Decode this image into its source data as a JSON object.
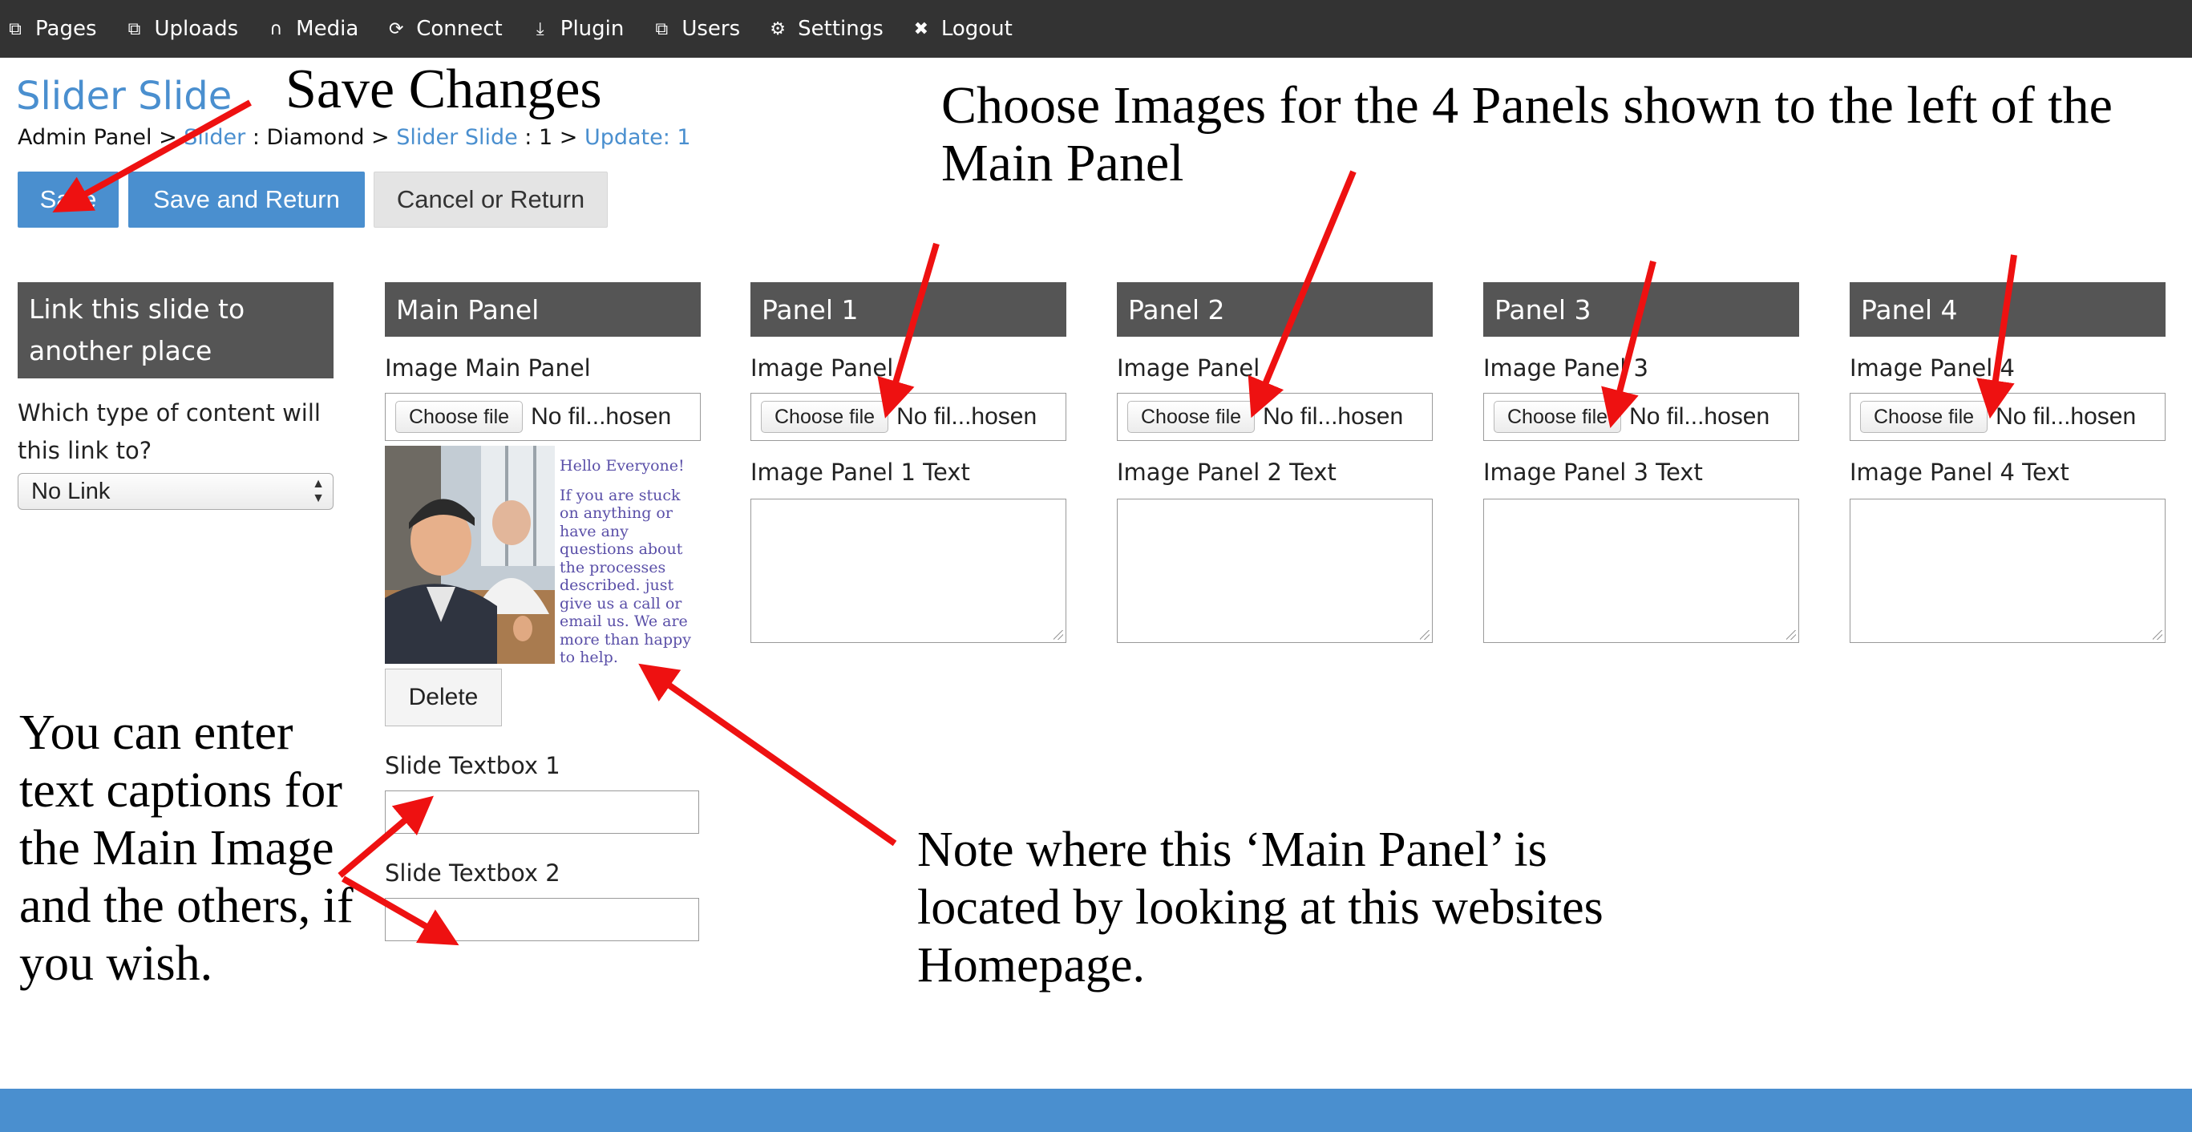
{
  "nav": {
    "items": [
      {
        "label": "Pages",
        "icon": "pages-icon",
        "glyph": "⧉"
      },
      {
        "label": "Uploads",
        "icon": "uploads-icon",
        "glyph": "⧉"
      },
      {
        "label": "Media",
        "icon": "headphones-icon",
        "glyph": "∩"
      },
      {
        "label": "Connect",
        "icon": "connect-icon",
        "glyph": "⟳"
      },
      {
        "label": "Plugin",
        "icon": "plugin-icon",
        "glyph": "⤓"
      },
      {
        "label": "Users",
        "icon": "users-icon",
        "glyph": "⧉"
      },
      {
        "label": "Settings",
        "icon": "gear-icon",
        "glyph": "⚙"
      },
      {
        "label": "Logout",
        "icon": "close-icon",
        "glyph": "✖"
      }
    ]
  },
  "header": {
    "title": "Slider Slide",
    "breadcrumb": {
      "admin": "Admin Panel",
      "sep1": " > ",
      "slider": "Slider",
      "colon1": " : Diamond > ",
      "slider_slide": "Slider Slide",
      "colon2": " : 1 > ",
      "update": "Update: 1"
    }
  },
  "toolbar": {
    "save": "Save",
    "save_return": "Save and Return",
    "cancel": "Cancel or Return"
  },
  "link_section": {
    "heading": "Link this slide to another place",
    "question": "Which type of content will this link to?",
    "selected": "No Link"
  },
  "main_panel": {
    "heading": "Main Panel",
    "image_label": "Image Main Panel",
    "choose": "Choose file",
    "no_file": "No fil...hosen",
    "preview": {
      "greeting": "Hello Everyone!",
      "body": "If you are stuck on anything or have any questions about the processes described. just give us a call or email us. We are more than happy to help."
    },
    "delete": "Delete",
    "textbox1": "Slide Textbox 1",
    "textbox2": "Slide Textbox 2"
  },
  "panels": [
    {
      "heading": "Panel 1",
      "image_label": "Image Panel",
      "choose": "Choose file",
      "no_file": "No fil...hosen",
      "text_label": "Image Panel 1 Text"
    },
    {
      "heading": "Panel 2",
      "image_label": "Image Panel",
      "choose": "Choose file",
      "no_file": "No fil...hosen",
      "text_label": "Image Panel 2 Text"
    },
    {
      "heading": "Panel 3",
      "image_label": "Image Panel 3",
      "choose": "Choose file",
      "no_file": "No fil...hosen",
      "text_label": "Image Panel 3 Text"
    },
    {
      "heading": "Panel 4",
      "image_label": "Image Panel 4",
      "choose": "Choose file",
      "no_file": "No fil...hosen",
      "text_label": "Image Panel 4 Text"
    }
  ],
  "annotations": {
    "save_changes": "Save Changes",
    "choose_images": "Choose Images for the 4 Panels shown to the left of the Main Panel",
    "captions": "You can enter text captions for the Main Image and the others, if you wish.",
    "note": "Note where this ‘Main Panel’ is located by looking at this websites Homepage."
  },
  "colors": {
    "accent": "#4a8fcf",
    "nav_bg": "#333333",
    "panel_head": "#555555",
    "arrow": "#ee1111"
  }
}
